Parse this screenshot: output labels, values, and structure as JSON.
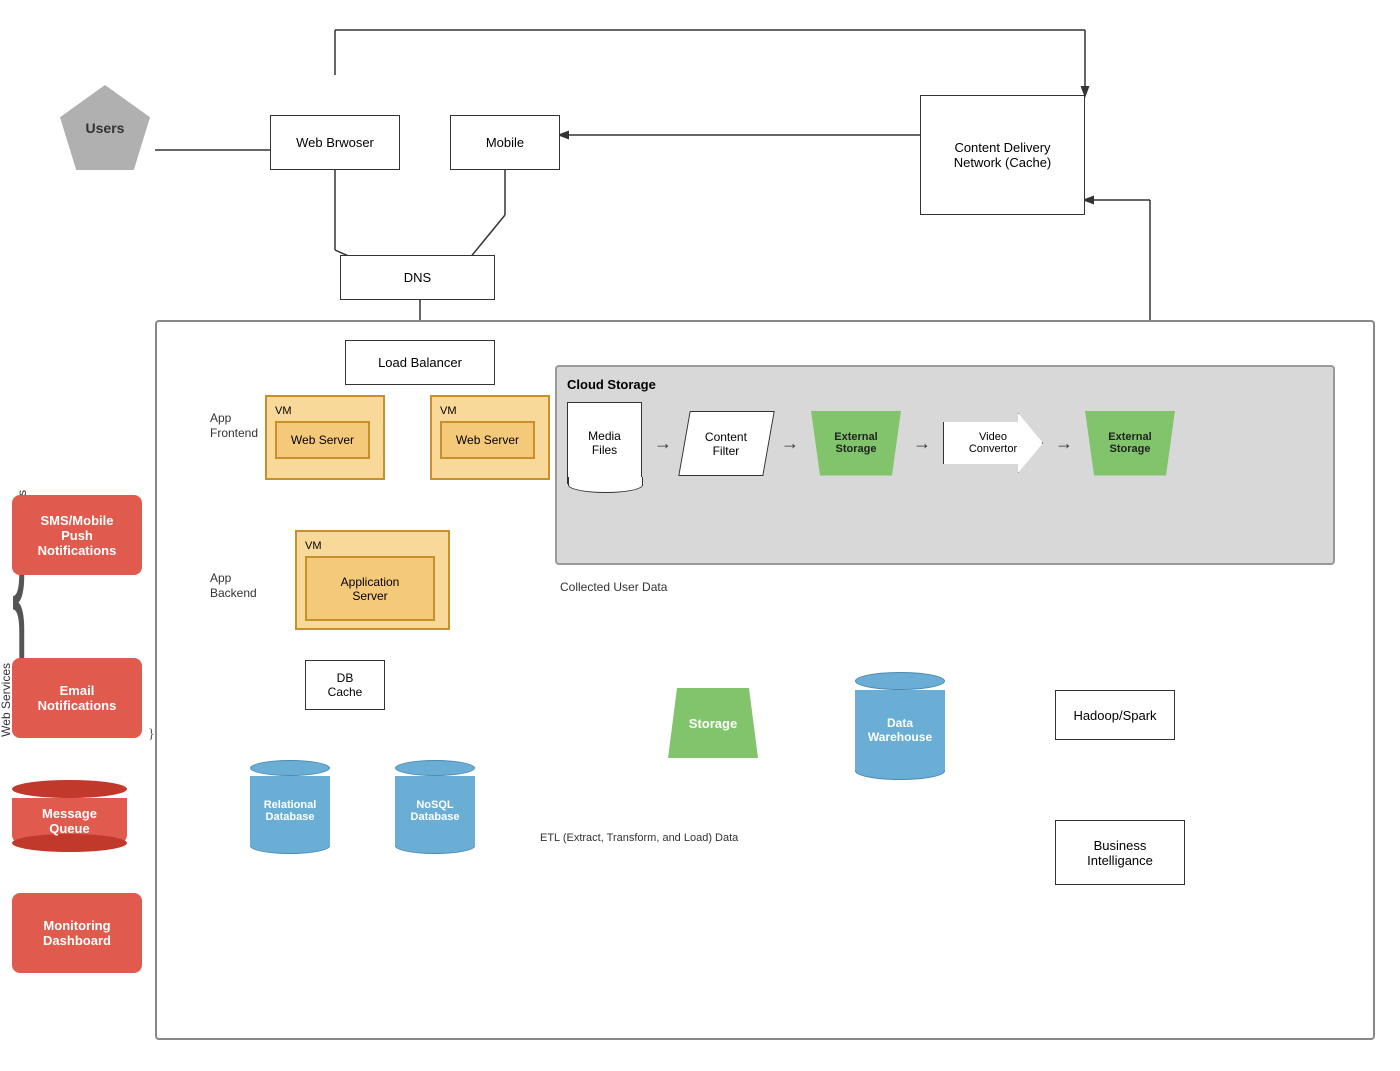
{
  "nodes": {
    "users": {
      "label": "Users"
    },
    "web_browser": {
      "label": "Web Brwoser"
    },
    "mobile": {
      "label": "Mobile"
    },
    "dns": {
      "label": "DNS"
    },
    "cdn": {
      "label": "Content Delivery\nNetwork (Cache)"
    },
    "load_balancer": {
      "label": "Load Balancer"
    },
    "app_frontend": {
      "label": "App Frontend"
    },
    "app_backend": {
      "label": "App Backend"
    },
    "vm1": {
      "label": "VM"
    },
    "vm2": {
      "label": "VM"
    },
    "vm3": {
      "label": "VM"
    },
    "web_server1": {
      "label": "Web Server"
    },
    "web_server2": {
      "label": "Web Server"
    },
    "app_server": {
      "label": "Application\nServer"
    },
    "db_cache": {
      "label": "DB\nCache"
    },
    "relational_db": {
      "label": "Relational\nDatabase"
    },
    "nosql_db": {
      "label": "NoSQL\nDatabase"
    },
    "cloud_storage": {
      "label": "Cloud Storage"
    },
    "media_files": {
      "label": "Media\nFiles"
    },
    "content_filter": {
      "label": "Content\nFilter"
    },
    "external_storage1": {
      "label": "External\nStorage"
    },
    "video_convertor": {
      "label": "Video\nConvertor"
    },
    "external_storage2": {
      "label": "External\nStorage"
    },
    "storage": {
      "label": "Storage"
    },
    "data_warehouse": {
      "label": "Data\nWarehouse"
    },
    "hadoop_spark": {
      "label": "Hadoop/Spark"
    },
    "business_intel": {
      "label": "Business\nIntelligance"
    },
    "collected_user_data": {
      "label": "Collected User Data"
    },
    "etl_label": {
      "label": "ETL (Extract, Transform, and Load) Data"
    },
    "web_services": {
      "label": "Web\nServices"
    },
    "sms_notifications": {
      "label": "SMS/Mobile\nPush\nNotifications"
    },
    "email_notifications": {
      "label": "Email\nNotifications"
    },
    "message_queue": {
      "label": "Message\nQueue"
    },
    "monitoring_dashboard": {
      "label": "Monitoring\nDashboard"
    }
  }
}
